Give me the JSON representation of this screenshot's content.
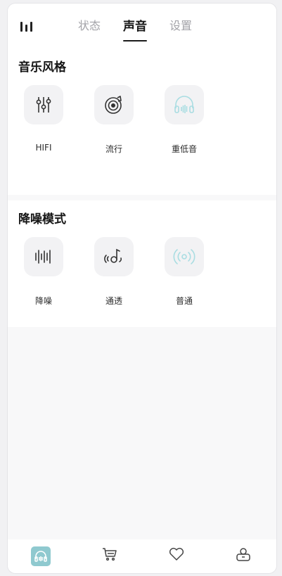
{
  "tabs": [
    "状态",
    "声音",
    "设置"
  ],
  "music_style": {
    "title": "音乐风格",
    "options": [
      {
        "label": "HIFI",
        "icon": "equalizer-icon"
      },
      {
        "label": "流行",
        "icon": "vinyl-record-icon"
      },
      {
        "label": "重低音",
        "icon": "headphones-icon"
      }
    ]
  },
  "noise_mode": {
    "title": "降噪模式",
    "options": [
      {
        "label": "降噪",
        "icon": "sound-wave-icon"
      },
      {
        "label": "通透",
        "icon": "ear-music-icon"
      },
      {
        "label": "普通",
        "icon": "broadcast-icon"
      }
    ]
  },
  "bottom_nav": [
    {
      "icon": "headphones-home-icon",
      "active": true
    },
    {
      "icon": "cart-icon"
    },
    {
      "icon": "heart-icon"
    },
    {
      "icon": "profile-icon"
    }
  ],
  "colors": {
    "accent": "#8fc9cf",
    "inactive_icon": "#a9dde2"
  }
}
